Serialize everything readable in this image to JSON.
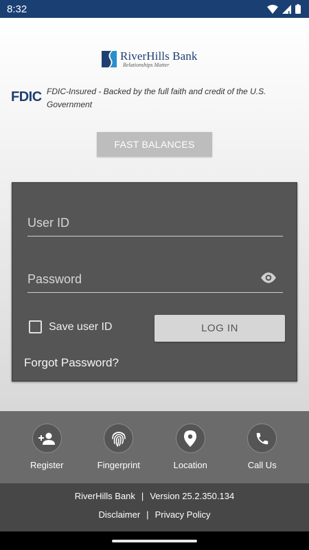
{
  "status_bar": {
    "time": "8:32"
  },
  "brand": {
    "name": "RiverHills Bank",
    "tagline": "Relationships Matter",
    "primary_color": "#1e3f72"
  },
  "fdic": {
    "logo": "FDIC",
    "text": "FDIC-Insured - Backed by the full faith and credit of the U.S. Government"
  },
  "fast_balances": {
    "label": "FAST BALANCES"
  },
  "login": {
    "userid_placeholder": "User ID",
    "password_placeholder": "Password",
    "save_userid_label": "Save user ID",
    "login_label": "LOG IN",
    "forgot_label": "Forgot Password?"
  },
  "actions": [
    {
      "label": "Register",
      "icon": "add-user-icon"
    },
    {
      "label": "Fingerprint",
      "icon": "fingerprint-icon"
    },
    {
      "label": "Location",
      "icon": "location-pin-icon"
    },
    {
      "label": "Call Us",
      "icon": "phone-icon"
    }
  ],
  "footer": {
    "bank_name": "RiverHills Bank",
    "separator": "|",
    "version": "Version 25.2.350.134",
    "disclaimer": "Disclaimer",
    "privacy": "Privacy Policy"
  }
}
